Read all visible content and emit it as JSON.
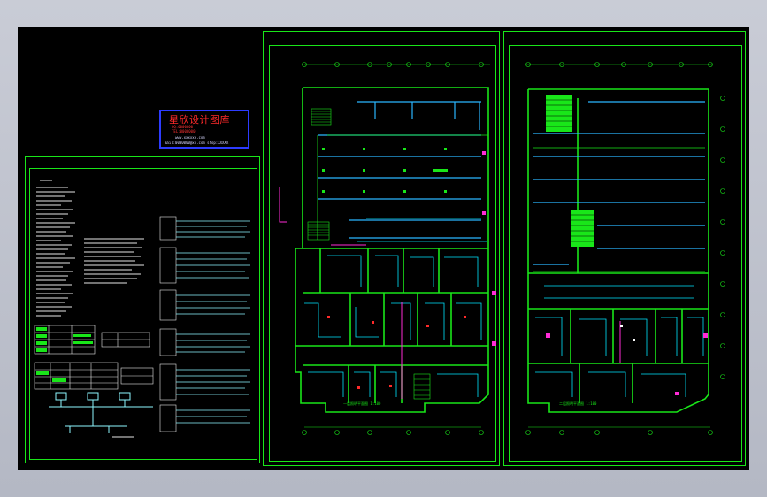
{
  "viewer": {
    "background": "#c4c7d1",
    "canvas_color": "#000000"
  },
  "stamp": {
    "title": "星欣设计图库",
    "line1": "QQ:0000000",
    "line2": "TEL:0000000",
    "line3": "www.xxxxxx.com",
    "line4": "mail:0000000@xx.com   shop:XXXXX",
    "border_color": "#2d3cff",
    "text_color": "#ff2a2a"
  },
  "sheets": [
    {
      "name": "design-notes-sheet",
      "caption": ""
    },
    {
      "name": "floor-plan-1",
      "caption": "一层照明平面图 1:100"
    },
    {
      "name": "floor-plan-2",
      "caption": "二层照明平面图 1:100"
    }
  ],
  "colors": {
    "frame": "#19e619",
    "walls": "#19e619",
    "lights": "#2ab6ff",
    "wiring": "#00e5ff",
    "accent_magenta": "#ff2bd6",
    "accent_red": "#ff2a2a",
    "stairs": "#19e619",
    "text_cyan": "#8ef7ff",
    "text_white": "#e6e6e6"
  }
}
